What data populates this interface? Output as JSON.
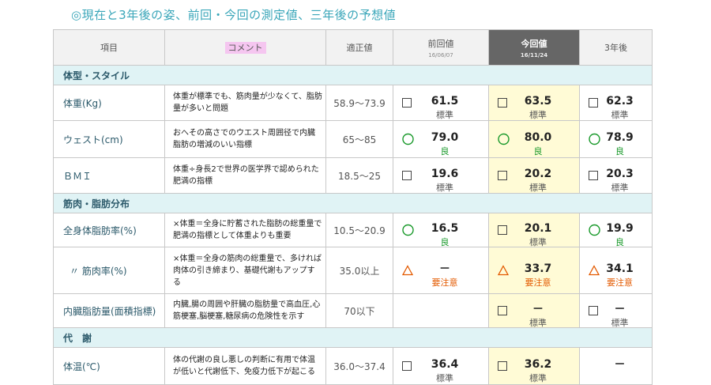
{
  "page_title": "◎現在と3年後の姿、前回・今回の測定値、三年後の予想値",
  "header": {
    "item": "項目",
    "comment": "コメント",
    "standard": "適正値",
    "prev_label": "前回値",
    "prev_date": "16/06/07",
    "curr_label": "今回値",
    "curr_date": "16/11/24",
    "future_label": "3年後"
  },
  "sections": {
    "body": "体型・スタイル",
    "muscle": "筋肉・脂肪分布",
    "metab": "代　謝"
  },
  "rows": [
    {
      "item": "体重(Kg)",
      "comment": "体重が標準でも、筋肉量が少なくて、脂肪量が多いと問題",
      "standard": "58.9～73.9",
      "prev": {
        "mark": "box",
        "value": "61.5",
        "judge": "標準"
      },
      "curr": {
        "mark": "box",
        "value": "63.5",
        "judge": "標準"
      },
      "future": {
        "mark": "box",
        "value": "62.3",
        "judge": "標準"
      }
    },
    {
      "item": "ウェスト(cm)",
      "comment": "おへその高さでのウエスト周囲径で内臓脂肪の増減のいい指標",
      "standard": "65～85",
      "prev": {
        "mark": "circle",
        "value": "79.0",
        "judge": "良"
      },
      "curr": {
        "mark": "circle",
        "value": "80.0",
        "judge": "良"
      },
      "future": {
        "mark": "circle",
        "value": "78.9",
        "judge": "良"
      }
    },
    {
      "item": "ＢＭＩ",
      "comment": "体重÷身長2で世界の医学界で認められた肥満の指標",
      "standard": "18.5～25",
      "prev": {
        "mark": "box",
        "value": "19.6",
        "judge": "標準"
      },
      "curr": {
        "mark": "box",
        "value": "20.2",
        "judge": "標準"
      },
      "future": {
        "mark": "box",
        "value": "20.3",
        "judge": "標準"
      }
    },
    {
      "item": "全身体脂肪率(%)",
      "comment": "×体重＝全身に貯蓄された脂肪の総重量で肥満の指標として体重よりも重要",
      "standard": "10.5～20.9",
      "prev": {
        "mark": "circle",
        "value": "16.5",
        "judge": "良"
      },
      "curr": {
        "mark": "box",
        "value": "20.1",
        "judge": "標準"
      },
      "future": {
        "mark": "circle",
        "value": "19.9",
        "judge": "良"
      }
    },
    {
      "item": "〃 筋肉率(%)",
      "comment": "×体重＝全身の筋肉の総重量で、多ければ肉体の引き締まり、基礎代謝もアップする",
      "standard": "35.0以上",
      "prev": {
        "mark": "triangle",
        "value": "－",
        "judge": "要注意"
      },
      "curr": {
        "mark": "triangle",
        "value": "33.7",
        "judge": "要注意"
      },
      "future": {
        "mark": "triangle",
        "value": "34.1",
        "judge": "要注意"
      }
    },
    {
      "item": "内臓脂肪量(面積指標)",
      "comment": "内臓,腸の周囲や肝臓の脂肪量で高血圧,心筋梗塞,脳梗塞,糖尿病の危険性を示す",
      "standard": "70以下",
      "prev": {
        "mark": "",
        "value": "",
        "judge": ""
      },
      "curr": {
        "mark": "box",
        "value": "－",
        "judge": "標準"
      },
      "future": {
        "mark": "box",
        "value": "－",
        "judge": "標準"
      }
    },
    {
      "item": "体温(℃)",
      "comment": "体の代謝の良し悪しの判断に有用で体温が低いと代謝低下、免疫力低下が起こる",
      "standard": "36.0～37.4",
      "prev": {
        "mark": "box",
        "value": "36.4",
        "judge": "標準"
      },
      "curr": {
        "mark": "box",
        "value": "36.2",
        "judge": "標準"
      },
      "future": {
        "mark": "",
        "value": "－",
        "judge": ""
      }
    }
  ]
}
